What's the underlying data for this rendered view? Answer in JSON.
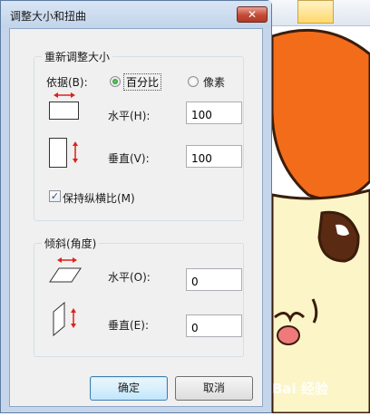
{
  "dialog": {
    "title": "调整大小和扭曲",
    "close_glyph": "✕"
  },
  "resize": {
    "group_title": "重新调整大小",
    "basis_label": "依据(B):",
    "percent_label": "百分比",
    "pixels_label": "像素",
    "selected": "percent",
    "horizontal_label": "水平(H):",
    "horizontal_value": "100",
    "vertical_label": "垂直(V):",
    "vertical_value": "100",
    "keep_ratio_label": "保持纵横比(M)",
    "keep_ratio_checked": true,
    "check_glyph": "✓"
  },
  "skew": {
    "group_title": "倾斜(角度)",
    "horizontal_label": "水平(O):",
    "horizontal_value": "0",
    "vertical_label": "垂直(E):",
    "vertical_value": "0"
  },
  "buttons": {
    "ok": "确定",
    "cancel": "取消"
  },
  "watermark": {
    "text": "Bai 经验"
  },
  "colors": {
    "arrow_red": "#e0201a",
    "hair_orange": "#f26c1a",
    "face_cream": "#fbf5c8"
  }
}
